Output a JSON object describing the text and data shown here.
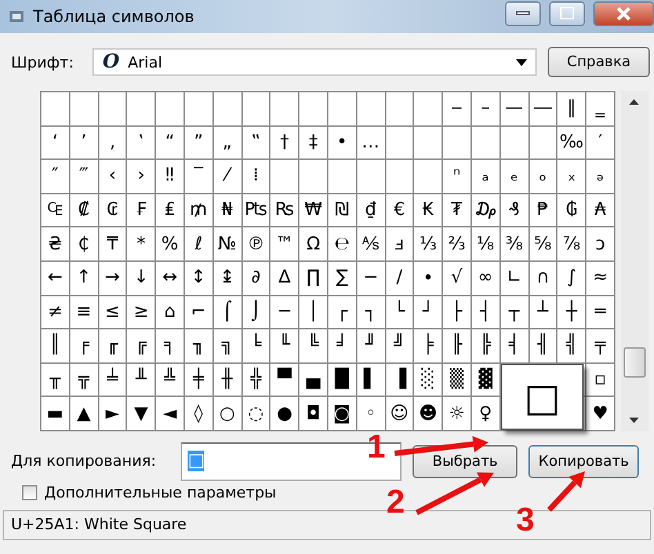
{
  "window": {
    "title": "Таблица символов"
  },
  "font_row": {
    "label": "Шрифт:",
    "font_glyph": "O",
    "value": "Arial",
    "help_button": "Справка"
  },
  "grid": {
    "rows": [
      [
        "",
        "",
        "",
        "",
        "",
        "",
        "",
        "",
        "",
        "",
        "",
        "",
        "",
        "",
        "‒",
        "–",
        "—",
        "―",
        "‖",
        "‗"
      ],
      [
        "‘",
        "’",
        "‚",
        "‛",
        "“",
        "”",
        "„",
        "‟",
        "†",
        "‡",
        "•",
        "…",
        "",
        "",
        "",
        "",
        "",
        "",
        "‰",
        "′"
      ],
      [
        "″",
        "‴",
        "‹",
        "›",
        "‼",
        "‾",
        "⁄",
        "⁞",
        "",
        "",
        "",
        "",
        "",
        "",
        "ⁿ",
        "ₐ",
        "ₑ",
        "ₒ",
        "ₓ",
        "ₔ"
      ],
      [
        "₠",
        "₡",
        "₢",
        "₣",
        "₤",
        "₥",
        "₦",
        "₧",
        "₨",
        "₩",
        "₪",
        "₫",
        "€",
        "₭",
        "₮",
        "₯",
        "₰",
        "₱",
        "₲",
        "₳"
      ],
      [
        "₴",
        "₵",
        "₸",
        "*",
        "%",
        "ℓ",
        "№",
        "℗",
        "™",
        "Ω",
        "℮",
        "⅍",
        "ⅎ",
        "⅓",
        "⅔",
        "⅛",
        "⅜",
        "⅝",
        "⅞",
        "ↄ"
      ],
      [
        "←",
        "↑",
        "→",
        "↓",
        "↔",
        "↕",
        "↨",
        "∂",
        "∆",
        "∏",
        "∑",
        "−",
        "∕",
        "∙",
        "√",
        "∞",
        "∟",
        "∩",
        "∫",
        "≈"
      ],
      [
        "≠",
        "≡",
        "≤",
        "≥",
        "⌂",
        "⌐",
        "⌠",
        "⌡",
        "─",
        "│",
        "┌",
        "┐",
        "└",
        "┘",
        "├",
        "┤",
        "┬",
        "┴",
        "┼",
        "═"
      ],
      [
        "║",
        "╒",
        "╓",
        "╔",
        "╕",
        "╖",
        "╗",
        "╘",
        "╙",
        "╚",
        "╛",
        "╜",
        "╝",
        "╞",
        "╟",
        "╠",
        "╡",
        "╢",
        "╣",
        "╤"
      ],
      [
        "╥",
        "╦",
        "╧",
        "╨",
        "╩",
        "╪",
        "╫",
        "╬",
        "▀",
        "▄",
        "█",
        "▌",
        "▐",
        "░",
        "▒",
        "▓",
        "",
        "",
        "",
        "▫"
      ],
      [
        "▬",
        "▲",
        "►",
        "▼",
        "◄",
        "◊",
        "○",
        "◌",
        "●",
        "◘",
        "◙",
        "◦",
        "☺",
        "☻",
        "☼",
        "♀",
        "",
        "",
        "",
        "♥"
      ]
    ],
    "magnified": "□"
  },
  "copy_row": {
    "label": "Для копирования:",
    "value": "□",
    "select_button": "Выбрать",
    "copy_button": "Копировать"
  },
  "advanced": {
    "label": "Дополнительные параметры",
    "checked": false
  },
  "status_bar": "U+25A1: White Square",
  "annotations": [
    "1",
    "2",
    "3"
  ]
}
